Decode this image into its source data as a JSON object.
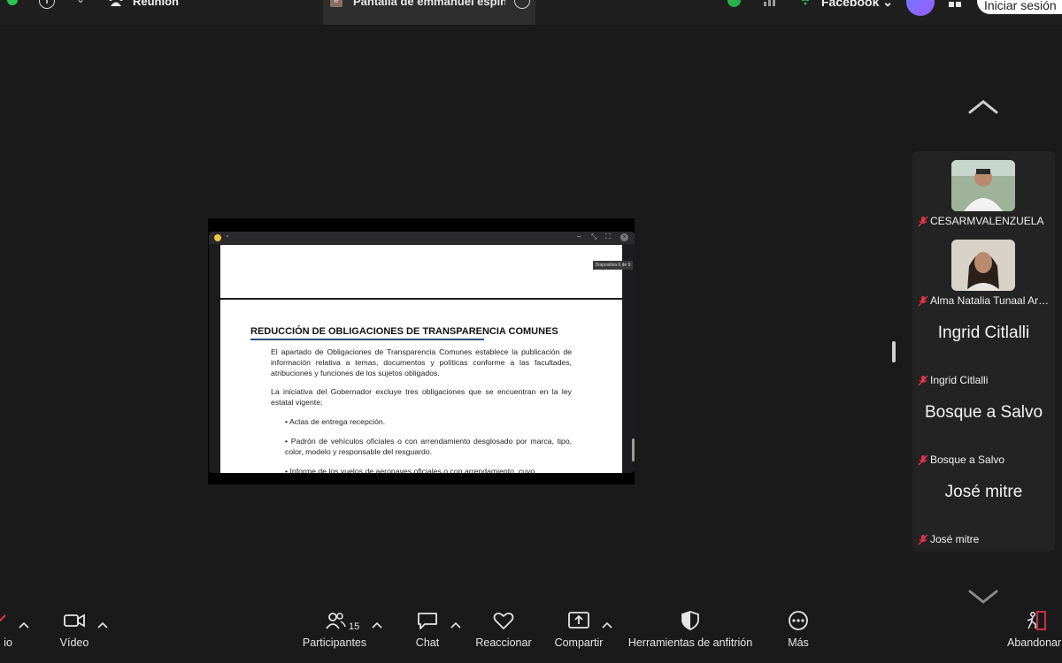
{
  "topbar": {
    "meeting_label": "Reunión",
    "tab_title": "Pantalla de emmanuel espino",
    "tab_icon_letter": "e",
    "facebook_label": "Facebook",
    "signin_label": "Iniciar sesión",
    "icons": [
      "status-dot",
      "info-icon",
      "chevron-down-icon",
      "people-icon",
      "more-icon",
      "shield-check-icon",
      "signal-icon",
      "wifi-icon",
      "ai-assistant-icon",
      "apps-icon"
    ]
  },
  "slide": {
    "counter": "Diapositiva 6 de 9",
    "title": "REDUCCIÓN DE OBLIGACIONES DE TRANSPARENCIA COMUNES",
    "p1": "El apartado de Obligaciones de Transparencia Comunes establece la publicación de información relativa a temas, documentos y políticas conforme a las facultades, atribuciones y funciones de los sujetos obligados.",
    "p2": "La iniciativa del Gobernador excluye tres obligaciones que se encuentran en la ley estatal vigente:",
    "b1": "• Actas de entrega recepción.",
    "b2": "• Padrón de vehículos oficiales o con arrendamiento desglosado por marca, tipo, color, modelo y responsable del resguardo.",
    "b3": "• Informe de los vuelos de aeronaves oficiales o con arrendamiento, cuyo"
  },
  "gallery": {
    "tiles": [
      {
        "label": "CESARMVALENZUELA",
        "big": ""
      },
      {
        "label": "Alma Natalia Tunaal Arias",
        "big": ""
      },
      {
        "label": "Ingrid Citlalli",
        "big": "Ingrid Citlalli"
      },
      {
        "label": "Bosque a Salvo",
        "big": "Bosque a Salvo"
      },
      {
        "label": "José mitre",
        "big": "José mitre"
      }
    ]
  },
  "toolbar": {
    "audio_label": "io",
    "video_label": "Vídeo",
    "participants_label": "Participantes",
    "participants_count": "15",
    "chat_label": "Chat",
    "react_label": "Reaccionar",
    "share_label": "Compartir",
    "host_label": "Herramientas de anfitrión",
    "more_label": "Más",
    "leave_label": "Abandonar"
  },
  "colors": {
    "background": "#1a1a1a",
    "tile": "#232323",
    "green": "#2fc44b",
    "muted_red": "#e0344a",
    "title_underline": "#2c4c86"
  }
}
